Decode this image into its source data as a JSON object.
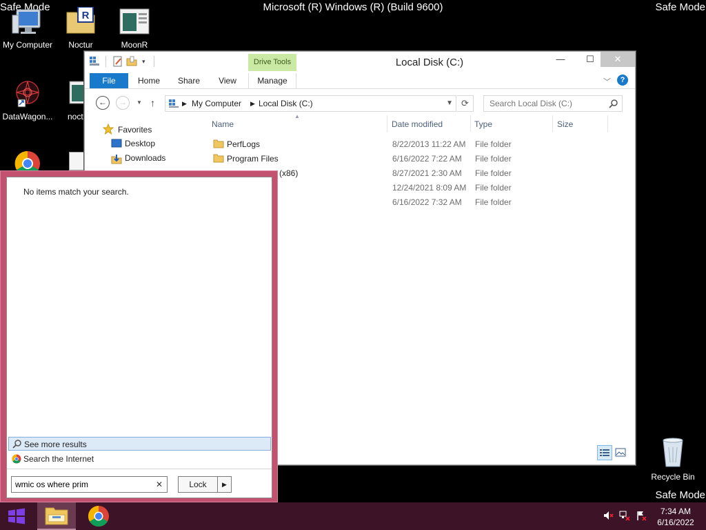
{
  "watermark": {
    "safe_mode": "Safe Mode",
    "build": "Microsoft (R) Windows (R) (Build 9600)"
  },
  "desktop": {
    "icons": [
      {
        "label": "My Computer"
      },
      {
        "label": "Noctur"
      },
      {
        "label": "MoonR"
      },
      {
        "label": "DataWagon..."
      },
      {
        "label": "noct"
      }
    ],
    "recycle_bin": "Recycle Bin"
  },
  "explorer": {
    "title": "Local Disk (C:)",
    "contextual_group": "Drive Tools",
    "tabs": {
      "file": "File",
      "home": "Home",
      "share": "Share",
      "view": "View",
      "manage": "Manage"
    },
    "address": {
      "root": "My Computer",
      "current": "Local Disk (C:)"
    },
    "search_placeholder": "Search Local Disk (C:)",
    "nav": {
      "favorites": "Favorites",
      "desktop": "Desktop",
      "downloads": "Downloads"
    },
    "columns": {
      "name": "Name",
      "date": "Date modified",
      "type": "Type",
      "size": "Size"
    },
    "files": [
      {
        "name": "PerfLogs",
        "date": "8/22/2013 11:22 AM",
        "type": "File folder"
      },
      {
        "name": "Program Files",
        "date": "6/16/2022 7:22 AM",
        "type": "File folder"
      },
      {
        "name": "(x86)",
        "date": "8/27/2021 2:30 AM",
        "type": "File folder"
      },
      {
        "name": "",
        "date": "12/24/2021 8:09 AM",
        "type": "File folder"
      },
      {
        "name": "",
        "date": "6/16/2022 7:32 AM",
        "type": "File folder"
      }
    ]
  },
  "search_pane": {
    "no_items": "No items match your search.",
    "see_more": "See more results",
    "search_internet": "Search the Internet",
    "query": "wmic os where prim",
    "lock_label": "Lock"
  },
  "taskbar": {
    "time": "7:34 AM",
    "date": "6/16/2022"
  },
  "colors": {
    "accent": "#1979ca",
    "start_border": "#c2526f",
    "taskbar": "#3d1427",
    "drive_tools": "#c9e9a5"
  }
}
